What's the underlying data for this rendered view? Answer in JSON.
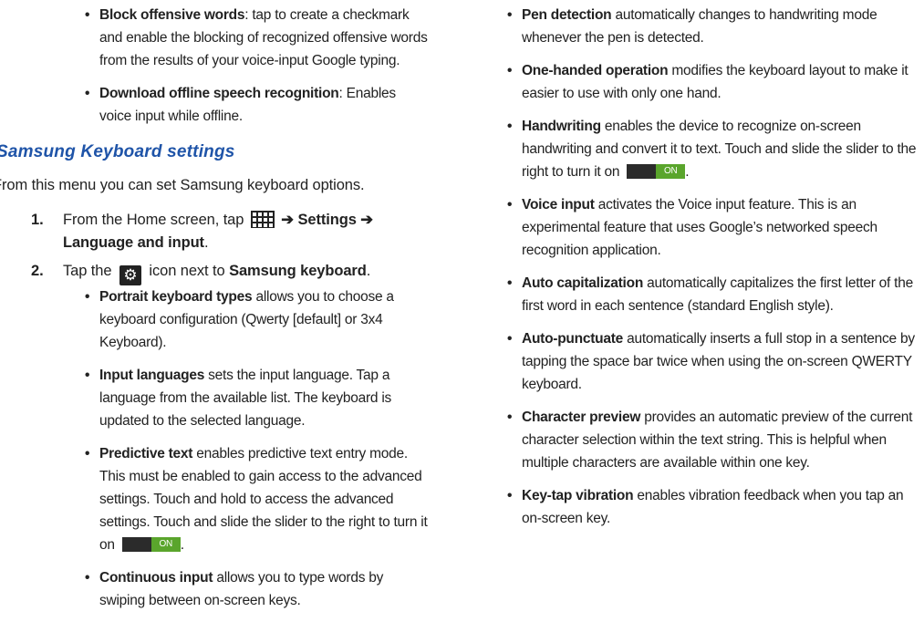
{
  "left": {
    "top_bullets": [
      {
        "title": "Block offensive words",
        "text": ": tap to create a checkmark and enable the blocking of recognized offensive words from the results of your voice-input Google typing."
      },
      {
        "title": "Download offline speech recognition",
        "text": ": Enables voice input while offline."
      }
    ],
    "section_title": "Samsung Keyboard settings",
    "intro": "From this menu you can set Samsung keyboard options.",
    "step1": {
      "num": "1.",
      "pre": "From the Home screen, tap",
      "arrow1": "➔",
      "settings": "Settings",
      "arrow2": "➔",
      "lang": "Language and input",
      "end": "."
    },
    "step2": {
      "num": "2.",
      "pre": "Tap the",
      "mid": "icon next to",
      "kb": "Samsung keyboard",
      "end": "."
    },
    "sub_bullets": [
      {
        "title": "Portrait keyboard types",
        "text": " allows you to choose a keyboard configuration (Qwerty [default] or 3x4 Keyboard)."
      },
      {
        "title": "Input languages",
        "text": " sets the input language. Tap a language from the available list. The keyboard is updated to the selected language."
      },
      {
        "title": "Predictive text",
        "text": " enables predictive text entry mode. This must be enabled to gain access to the advanced settings. Touch and hold to access the advanced settings. Touch and slide the slider to the right to turn it on",
        "toggle": "ON",
        "after": "."
      },
      {
        "title": "Continuous input",
        "text": " allows you to type words by swiping between on-screen keys."
      }
    ]
  },
  "right": {
    "bullets": [
      {
        "title": "Pen detection",
        "text": " automatically changes to handwriting mode whenever the pen is detected."
      },
      {
        "title": "One-handed operation",
        "text": " modifies the keyboard layout to make it easier to use with only one hand."
      },
      {
        "title": "Handwriting",
        "text": " enables the device to recognize on-screen handwriting and convert it to text. Touch and slide the slider to the right to turn it on",
        "toggle": "ON",
        "after": "."
      },
      {
        "title": "Voice input",
        "text": " activates the Voice input feature. This is an experimental feature that uses Google’s networked speech recognition application."
      },
      {
        "title": "Auto capitalization",
        "text": " automatically capitalizes the first letter of the first word in each sentence (standard English style)."
      },
      {
        "title": "Auto-punctuate",
        "text": " automatically inserts a full stop in a sentence by tapping the space bar twice when using the on-screen QWERTY keyboard."
      },
      {
        "title": "Character preview",
        "text": " provides an automatic preview of the current character selection within the text string. This is helpful when multiple characters are available within one key."
      },
      {
        "title": "Key-tap vibration",
        "text": " enables vibration feedback when you tap an on-screen key."
      }
    ]
  }
}
